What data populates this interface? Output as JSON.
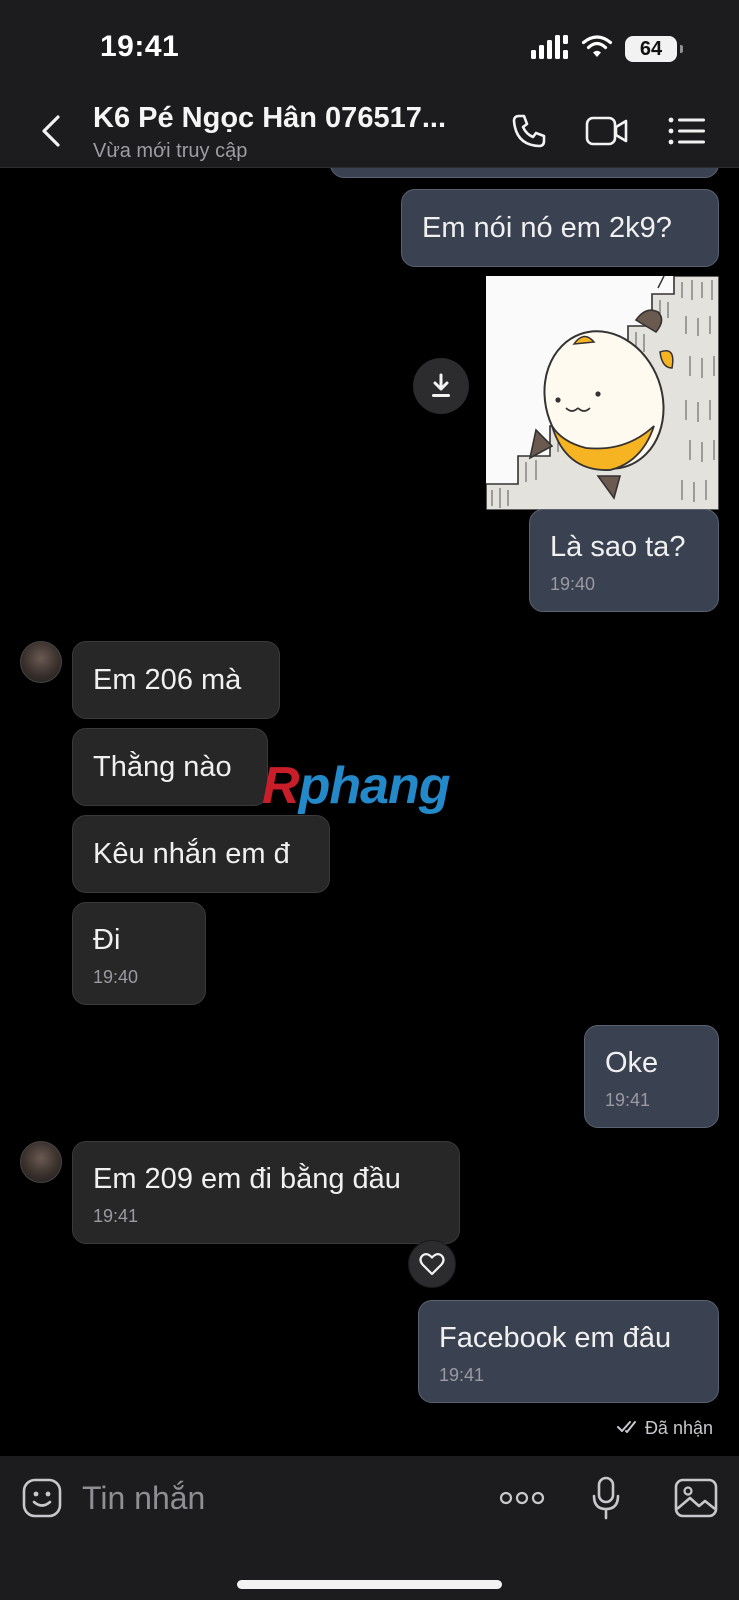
{
  "status_bar": {
    "time": "19:41",
    "battery": "64"
  },
  "header": {
    "contact_name": "K6 Pé Ngọc Hân 076517...",
    "status": "Vừa mới truy cập",
    "icons": [
      "back-chevron-icon",
      "phone-icon",
      "video-camera-icon",
      "menu-list-icon"
    ]
  },
  "messages": [
    {
      "dir": "out",
      "text": "Em nói nó em 2k9?"
    },
    {
      "dir": "out",
      "type": "sticker",
      "sticker": "cat-on-stairs-sticker"
    },
    {
      "dir": "out",
      "text": "Là sao ta?",
      "time": "19:40"
    },
    {
      "dir": "in",
      "text": "Em 206 mà"
    },
    {
      "dir": "in",
      "text": "Thằng nào"
    },
    {
      "dir": "in",
      "text": "Kêu nhắn em đ"
    },
    {
      "dir": "in",
      "text": "Đi",
      "time": "19:40"
    },
    {
      "dir": "out",
      "text": "Oke",
      "time": "19:41"
    },
    {
      "dir": "in",
      "text": "Em 209 em đi bằng đầu",
      "time": "19:41"
    },
    {
      "dir": "out",
      "text": "Facebook em đâu",
      "time": "19:41"
    }
  ],
  "watermark": {
    "first": "R",
    "rest": "phang"
  },
  "receipt": {
    "text": "Đã nhận"
  },
  "input": {
    "placeholder": "Tin nhắn",
    "icons": [
      "emoji-icon",
      "more-dots-icon",
      "microphone-icon",
      "image-gallery-icon"
    ]
  },
  "colors": {
    "outgoing_bubble": "#3a4150",
    "incoming_bubble": "#272727",
    "background": "#000000",
    "watermark_red": "#c81e2a",
    "watermark_blue": "#2389c9"
  }
}
